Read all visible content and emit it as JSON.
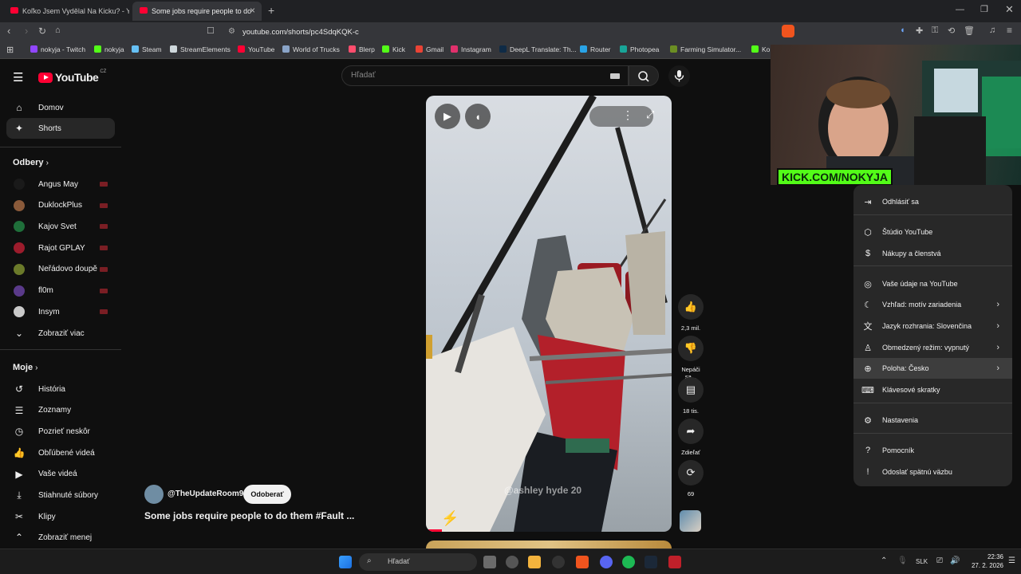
{
  "browser": {
    "tabs": [
      {
        "title": "Koľko Jsem Vydělal Na Kicku? - YouTu"
      },
      {
        "title": "Some jobs require people to do"
      }
    ],
    "url": "youtube.com/shorts/pc4SdqKQK-c",
    "bookmarks": [
      {
        "label": "nokyja - Twitch",
        "color": "#9146ff"
      },
      {
        "label": "nokyja",
        "color": "#53fc18"
      },
      {
        "label": "Steam",
        "color": "#66c0f4"
      },
      {
        "label": "StreamElements",
        "color": "#cfd8dc"
      },
      {
        "label": "YouTube",
        "color": "#ff0033"
      },
      {
        "label": "World of Trucks",
        "color": "#8aa4c8"
      },
      {
        "label": "Blerp",
        "color": "#ff4d6d"
      },
      {
        "label": "Kick",
        "color": "#53fc18"
      },
      {
        "label": "Gmail",
        "color": "#ea4335"
      },
      {
        "label": "Instagram",
        "color": "#e1306c"
      },
      {
        "label": "DeepL Translate: Th...",
        "color": "#0f2b46"
      },
      {
        "label": "Router",
        "color": "#29a3e6"
      },
      {
        "label": "Photopea",
        "color": "#18a497"
      },
      {
        "label": "Farming Simulator...",
        "color": "#6b8e23"
      },
      {
        "label": "Ko",
        "color": "#53fc18"
      }
    ]
  },
  "youtube": {
    "logo": "YouTube",
    "country": "CZ",
    "search_placeholder": "Hľadať",
    "sidebar": {
      "main": [
        {
          "label": "Domov",
          "icon": "home-icon"
        },
        {
          "label": "Shorts",
          "icon": "shorts-icon"
        }
      ],
      "subs_header": "Odbery",
      "subs": [
        {
          "label": "Angus May",
          "color": "#1a1a1a"
        },
        {
          "label": "DuklockPlus",
          "color": "#8a5a3a"
        },
        {
          "label": "Kajov Svet",
          "color": "#1f6f3a"
        },
        {
          "label": "Rajot GPLAY",
          "color": "#9c1c2c"
        },
        {
          "label": "Neřádovo doupě",
          "color": "#6b7a2a"
        },
        {
          "label": "fl0m",
          "color": "#5a3a8a"
        },
        {
          "label": "Insym",
          "color": "#c9c9c9"
        }
      ],
      "show_more": "Zobraziť viac",
      "you_header": "Moje",
      "you": [
        {
          "label": "História",
          "icon": "history-icon"
        },
        {
          "label": "Zoznamy",
          "icon": "playlists-icon"
        },
        {
          "label": "Pozrieť neskôr",
          "icon": "watch-later-icon"
        },
        {
          "label": "Obľúbené videá",
          "icon": "liked-icon"
        },
        {
          "label": "Vaše videá",
          "icon": "your-videos-icon"
        },
        {
          "label": "Stiahnuté súbory",
          "icon": "downloads-icon"
        },
        {
          "label": "Klipy",
          "icon": "clips-icon"
        }
      ],
      "show_less": "Zobraziť menej"
    },
    "short": {
      "channel": "@TheUpdateRoom99",
      "subscribe": "Odoberať",
      "title": "Some jobs require people to do them #Fault ...",
      "watermark": "@ashley hyde 20",
      "actions": [
        {
          "count": "2,3 mil.",
          "icon": "like-icon"
        },
        {
          "count": "Nepáči sa...",
          "icon": "dislike-icon"
        },
        {
          "count": "18 tis.",
          "icon": "comments-icon"
        },
        {
          "count": "Zdieľať",
          "icon": "share-icon"
        },
        {
          "count": "69",
          "icon": "remix-icon"
        }
      ]
    },
    "account_menu": {
      "items": [
        {
          "label": "Odhlásiť sa",
          "icon": "⇥",
          "arrow": false
        },
        {
          "label": "Štúdio YouTube",
          "icon": "⬡",
          "arrow": false
        },
        {
          "label": "Nákupy a členstvá",
          "icon": "$",
          "arrow": false
        },
        {
          "label": "Vaše údaje na YouTube",
          "icon": "◎",
          "arrow": false
        },
        {
          "label": "Vzhľad: motív zariadenia",
          "icon": "☾",
          "arrow": true
        },
        {
          "label": "Jazyk rozhrania: Slovenčina",
          "icon": "文",
          "arrow": true
        },
        {
          "label": "Obmedzený režim: vypnutý",
          "icon": "♙",
          "arrow": true
        },
        {
          "label": "Poloha: Česko",
          "icon": "⊕",
          "arrow": true
        },
        {
          "label": "Klávesové skratky",
          "icon": "⌨",
          "arrow": false
        },
        {
          "label": "Nastavenia",
          "icon": "⚙",
          "arrow": false
        },
        {
          "label": "Pomocník",
          "icon": "?",
          "arrow": false
        },
        {
          "label": "Odoslať spätnú väzbu",
          "icon": "!",
          "arrow": false
        }
      ]
    }
  },
  "overlay": {
    "kick_banner": "KICK.COM/NOKYJA"
  },
  "taskbar": {
    "search": "Hľadať",
    "lang": "SLK",
    "time": "22:36",
    "date": "27. 2. 2026"
  }
}
